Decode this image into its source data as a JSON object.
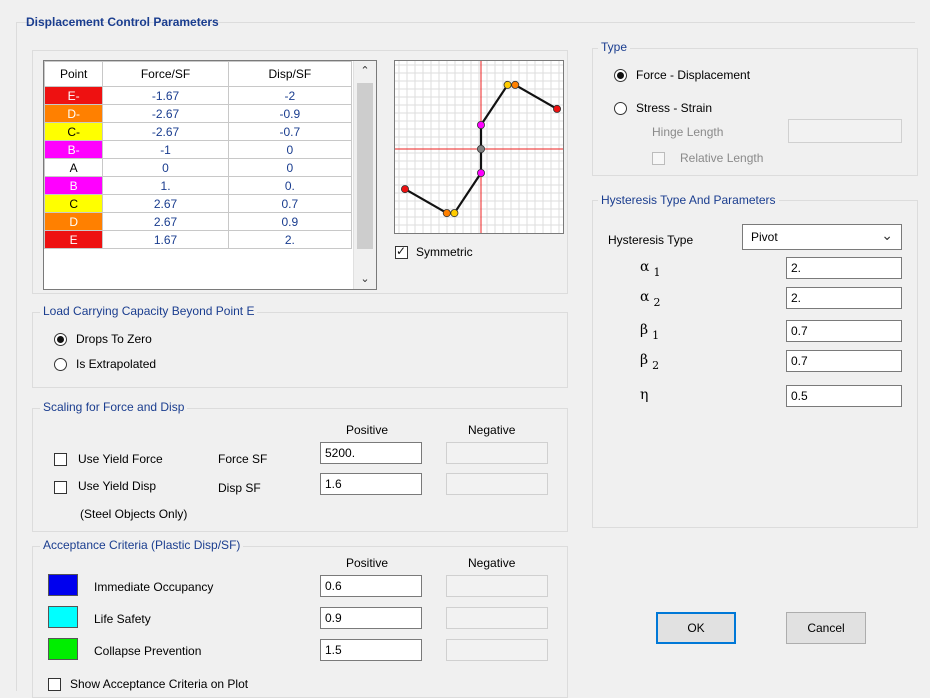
{
  "dialog_title": "Displacement Control Parameters",
  "table": {
    "headers": [
      "Point",
      "Force/SF",
      "Disp/SF"
    ],
    "rows": [
      {
        "point": "E-",
        "force": "-1.67",
        "disp": "-2",
        "color": "#ee1111",
        "text_color": "#ffffff"
      },
      {
        "point": "D-",
        "force": "-2.67",
        "disp": "-0.9",
        "color": "#ff8000",
        "text_color": "#ffffff"
      },
      {
        "point": "C-",
        "force": "-2.67",
        "disp": "-0.7",
        "color": "#ffff00",
        "text_color": "#000000"
      },
      {
        "point": "B-",
        "force": "-1",
        "disp": "0",
        "color": "#ff00ff",
        "text_color": "#ffffff"
      },
      {
        "point": "A",
        "force": "0",
        "disp": "0",
        "color": "#ffffff",
        "text_color": "#000000"
      },
      {
        "point": "B",
        "force": "1.",
        "disp": "0.",
        "color": "#ff00ff",
        "text_color": "#ffffff"
      },
      {
        "point": "C",
        "force": "2.67",
        "disp": "0.7",
        "color": "#ffff00",
        "text_color": "#000000"
      },
      {
        "point": "D",
        "force": "2.67",
        "disp": "0.9",
        "color": "#ff8000",
        "text_color": "#ffffff"
      },
      {
        "point": "E",
        "force": "1.67",
        "disp": "2.",
        "color": "#ee1111",
        "text_color": "#ffffff"
      }
    ]
  },
  "plot": {
    "points": [
      {
        "disp": -2,
        "force": -1.67,
        "color": "#ee1111"
      },
      {
        "disp": -0.9,
        "force": -2.67,
        "color": "#ff8000"
      },
      {
        "disp": -0.7,
        "force": -2.67,
        "color": "#ffcc00"
      },
      {
        "disp": 0,
        "force": -1,
        "color": "#ff00ff"
      },
      {
        "disp": 0,
        "force": 0,
        "color": "#808080"
      },
      {
        "disp": 0,
        "force": 1,
        "color": "#ff00ff"
      },
      {
        "disp": 0.7,
        "force": 2.67,
        "color": "#ffcc00"
      },
      {
        "disp": 0.9,
        "force": 2.67,
        "color": "#ff8000"
      },
      {
        "disp": 2,
        "force": 1.67,
        "color": "#ee1111"
      }
    ]
  },
  "symmetric": {
    "label": "Symmetric",
    "checked": true
  },
  "load_capacity": {
    "legend": "Load Carrying Capacity Beyond Point E",
    "opt1": "Drops To Zero",
    "opt2": "Is Extrapolated"
  },
  "scaling": {
    "legend": "Scaling for Force and Disp",
    "positive": "Positive",
    "negative": "Negative",
    "use_yield_force": "Use Yield Force",
    "force_sf_label": "Force SF",
    "force_sf_value": "5200.",
    "use_yield_disp": "Use Yield Disp",
    "disp_sf_label": "Disp SF",
    "disp_sf_value": "1.6",
    "steel_note": "(Steel Objects Only)"
  },
  "acceptance": {
    "legend": "Acceptance Criteria (Plastic Disp/SF)",
    "positive": "Positive",
    "negative": "Negative",
    "io_label": "Immediate Occupancy",
    "io_value": "0.6",
    "io_color": "#0000ee",
    "ls_label": "Life Safety",
    "ls_value": "0.9",
    "ls_color": "#00ffff",
    "cp_label": "Collapse Prevention",
    "cp_value": "1.5",
    "cp_color": "#00ee00",
    "show_label": "Show Acceptance Criteria on Plot"
  },
  "type": {
    "legend": "Type",
    "force_disp": "Force - Displacement",
    "stress_strain": "Stress - Strain",
    "hinge_length": "Hinge Length",
    "relative_length": "Relative Length"
  },
  "hysteresis": {
    "legend": "Hysteresis Type And Parameters",
    "type_label": "Hysteresis Type",
    "type_value": "Pivot",
    "params": [
      {
        "sym": "α",
        "sub": "1",
        "value": "2."
      },
      {
        "sym": "α",
        "sub": "2",
        "value": "2."
      },
      {
        "sym": "β",
        "sub": "1",
        "value": "0.7"
      },
      {
        "sym": "β",
        "sub": "2",
        "value": "0.7"
      },
      {
        "sym": "η",
        "sub": "",
        "value": "0.5"
      }
    ]
  },
  "buttons": {
    "ok": "OK",
    "cancel": "Cancel"
  }
}
